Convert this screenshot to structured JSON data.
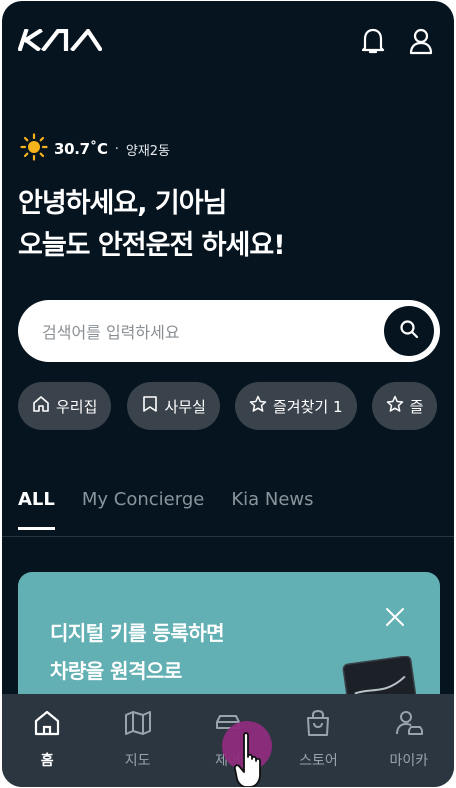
{
  "brand": {
    "logo": "KIA",
    "logo_icon": "kia-logo"
  },
  "header": {
    "notification_icon": "bell-icon",
    "profile_icon": "person-icon"
  },
  "weather": {
    "icon": "sun-icon",
    "temperature": "30.7˚C",
    "separator": "·",
    "location": "양재2동"
  },
  "greeting": {
    "line1": "안녕하세요, 기아님",
    "line2": "오늘도 안전운전 하세요!"
  },
  "search": {
    "placeholder": "검색어를 입력하세요",
    "value": "",
    "icon": "search-icon"
  },
  "quick_places": [
    {
      "label": "우리집",
      "icon": "home-icon"
    },
    {
      "label": "사무실",
      "icon": "bookmark-icon"
    },
    {
      "label": "즐겨찾기 1",
      "icon": "star-icon"
    },
    {
      "label": "즐",
      "icon": "star-icon"
    }
  ],
  "tabs": [
    {
      "label": "ALL",
      "active": true
    },
    {
      "label": "My Concierge",
      "active": false
    },
    {
      "label": "Kia News",
      "active": false
    }
  ],
  "promo_card": {
    "line1": "디지털 키를 등록하면",
    "line2": "차량을 원격으로",
    "close_icon": "close-icon",
    "background": "#62b0b3"
  },
  "bottom_nav": [
    {
      "label": "홈",
      "icon": "home-icon",
      "active": true
    },
    {
      "label": "지도",
      "icon": "map-icon",
      "active": false
    },
    {
      "label": "제어",
      "icon": "car-icon",
      "active": false
    },
    {
      "label": "스토어",
      "icon": "shopping-bag-icon",
      "active": false
    },
    {
      "label": "마이카",
      "icon": "user-car-icon",
      "active": false
    }
  ],
  "colors": {
    "background": "#06141f",
    "chip": "#3a434b",
    "nav": "#2b3640",
    "tap_highlight": "#8e2c7d"
  }
}
